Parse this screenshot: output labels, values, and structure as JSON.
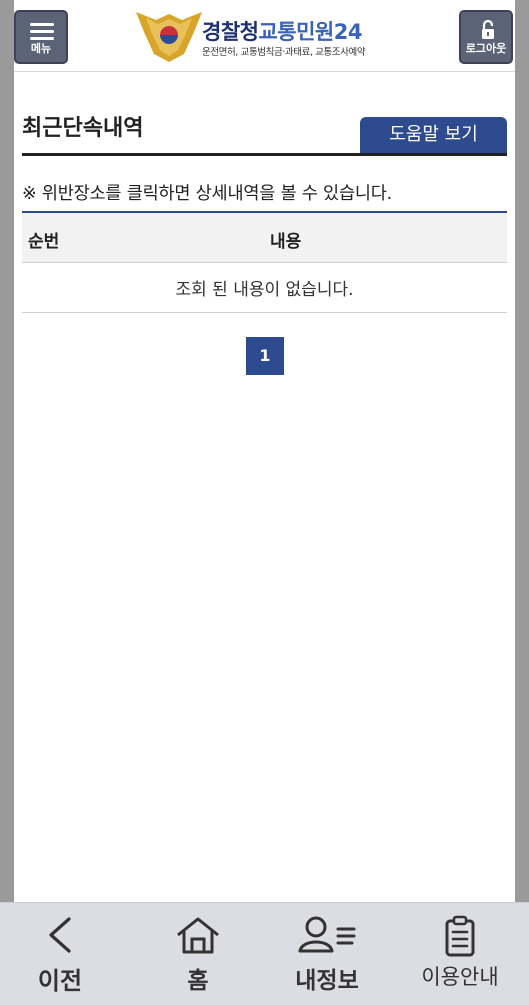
{
  "header": {
    "menu_label": "메뉴",
    "logout_label": "로그아웃",
    "logo_title_main": "경찰청",
    "logo_title_sub": "교통민원24",
    "logo_subtitle": "운전면허, 교통범칙금·과태료, 교통조사예약"
  },
  "main": {
    "section_title": "최근단속내역",
    "help_button": "도움말 보기",
    "notice": "※ 위반장소를 클릭하면 상세내역을 볼 수 있습니다.",
    "table": {
      "headers": [
        "순번",
        "내용"
      ],
      "empty_message": "조회 된 내용이 없습니다."
    },
    "pagination": {
      "current_page": "1"
    }
  },
  "bottom_nav": {
    "prev": "이전",
    "home": "홈",
    "my_info": "내정보",
    "guide": "이용안내"
  },
  "colors": {
    "accent": "#2d4b8e",
    "header_button": "#5b6377",
    "nav_background": "#dcdde3"
  }
}
